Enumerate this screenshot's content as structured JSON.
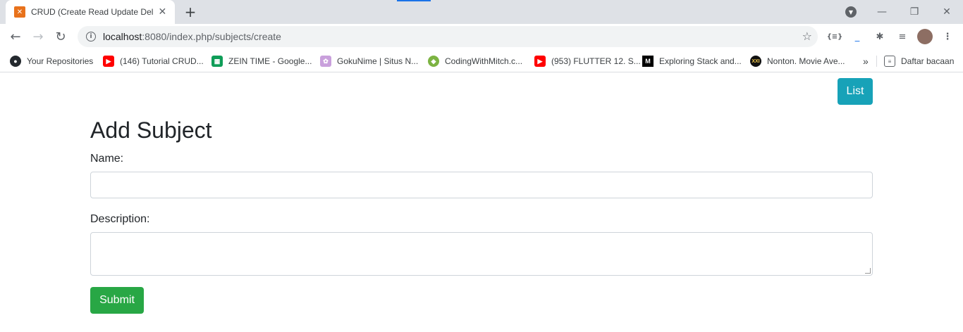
{
  "browser": {
    "tab_title": "CRUD (Create Read Update Delete",
    "tab_close": "✕",
    "new_tab": "+",
    "url_host": "localhost",
    "url_rest": ":8080/index.php/subjects/create",
    "window_controls": {
      "minimize": "—",
      "restore": "❐",
      "close": "✕"
    }
  },
  "bookmarks": [
    {
      "label": "Your Repositories",
      "icon": "github-icon",
      "color": "#24292e"
    },
    {
      "label": "(146) Tutorial CRUD...",
      "icon": "youtube-icon",
      "color": "#ff0000"
    },
    {
      "label": "ZEIN TIME - Google...",
      "icon": "sheets-icon",
      "color": "#0f9d58"
    },
    {
      "label": "GokuNime | Situs N...",
      "icon": "anime-icon",
      "color": "#c9a0dc"
    },
    {
      "label": "CodingWithMitch.c...",
      "icon": "android-icon",
      "color": "#7cb342"
    },
    {
      "label": "(953) FLUTTER 12. S...",
      "icon": "youtube-icon",
      "color": "#ff0000"
    },
    {
      "label": "Exploring Stack and...",
      "icon": "medium-icon",
      "color": "#000000"
    },
    {
      "label": "Nonton. Movie Ave...",
      "icon": "xxi-icon",
      "color": "#111111"
    }
  ],
  "bookmarks_more": "»",
  "reading_list": "Daftar bacaan",
  "page": {
    "list_button": "List",
    "heading": "Add Subject",
    "name_label": "Name:",
    "name_value": "",
    "description_label": "Description:",
    "description_value": "",
    "submit_button": "Submit"
  },
  "colors": {
    "list_button": "#17a2b8",
    "submit_button": "#28a745",
    "tab_favicon": "#e8721c"
  }
}
